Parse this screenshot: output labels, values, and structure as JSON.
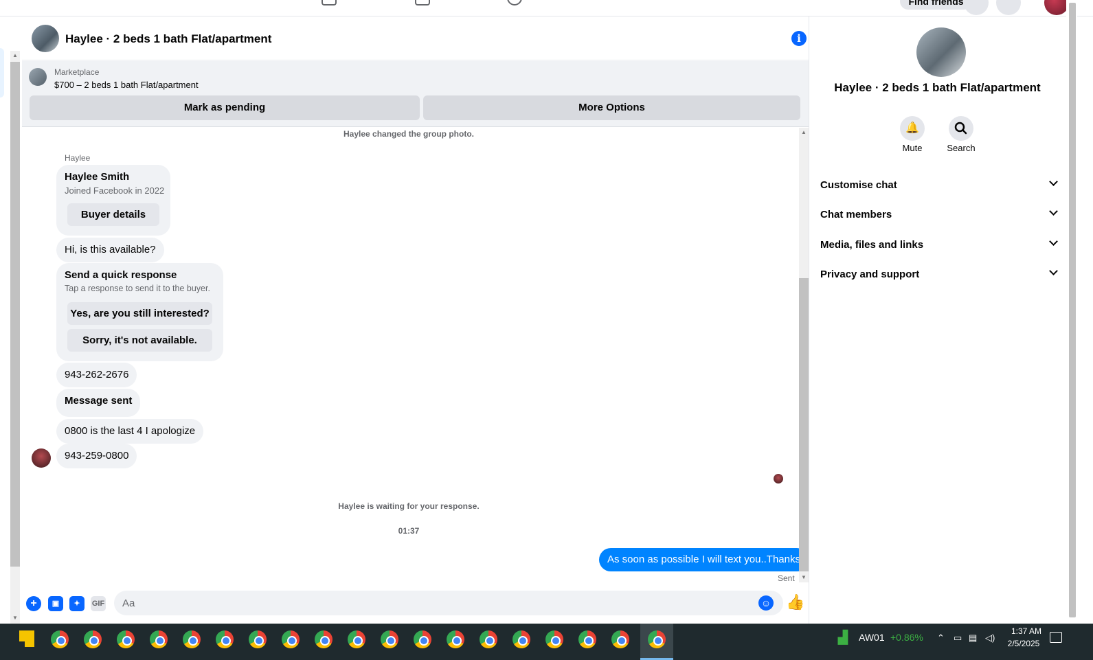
{
  "topnav": {
    "find_friends": "Find friends"
  },
  "chat": {
    "title": "Haylee · 2 beds 1 bath Flat/apartment",
    "marketplace": {
      "label": "Marketplace",
      "listing": "$700 – 2 beds 1 bath Flat/apartment",
      "mark_pending": "Mark as pending",
      "more_options": "More Options"
    },
    "system_group_photo": "Haylee changed the group photo.",
    "sender_name": "Haylee",
    "profile_card": {
      "name": "Haylee Smith",
      "joined": "Joined Facebook in 2022",
      "button": "Buyer details"
    },
    "msg_available": "Hi, is this available?",
    "quick_response": {
      "title": "Send a quick response",
      "subtitle": "Tap a response to send it to the buyer.",
      "option_1": "Yes, are you still interested?",
      "option_2": "Sorry, it's not available."
    },
    "msg_phone_1": "943-262-2676",
    "msg_sent_notice": "Message sent",
    "msg_apology": "0800 is the last 4 I apologize",
    "msg_phone_2": "943-259-0800",
    "system_waiting": "Haylee is waiting for your response.",
    "timestamp": "01:37",
    "outgoing": "As soon as possible I will text you..Thanks",
    "outgoing_status": "Sent",
    "composer_placeholder": "Aa",
    "composer_gif": "GIF"
  },
  "right_panel": {
    "title": "Haylee · 2 beds 1 bath Flat/apartment",
    "mute": "Mute",
    "search": "Search",
    "sections": [
      "Customise chat",
      "Chat members",
      "Media, files and links",
      "Privacy and support"
    ]
  },
  "taskbar": {
    "stock_symbol": "AW01",
    "stock_change": "+0.86%",
    "time": "1:37 AM",
    "date": "2/5/2025"
  },
  "colors": {
    "accent": "#0866ff",
    "outgoing_bubble": "#0084ff",
    "stock_up": "#3cb043"
  },
  "icons": [
    "info-icon",
    "plus-icon",
    "image-icon",
    "sticker-icon",
    "gif-icon",
    "emoji-icon",
    "like-icon",
    "bell-icon",
    "search-icon",
    "chevron-down-icon"
  ]
}
